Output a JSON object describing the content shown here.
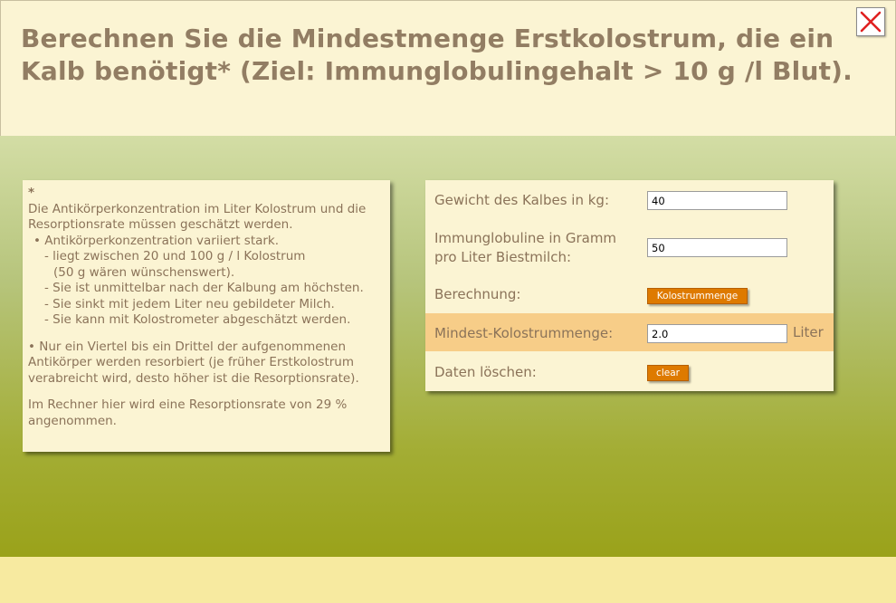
{
  "header": {
    "title": "Berechnen Sie die Mindestmenge Erstkolostrum, die ein Kalb benötigt* (Ziel: Immunglobulingehalt > 10 g /l Blut)."
  },
  "close_icon": "close-x-icon",
  "info": {
    "star": "*",
    "intro": "Die Antikörperkonzentration im Liter Kolostrum und die Resorptionsrate müssen geschätzt werden.",
    "bullet1": "• Antikörperkonzentration variiert stark.",
    "sub1": "- liegt zwischen 20 und 100 g / l Kolostrum",
    "sub1b": "(50 g wären wünschenswert).",
    "sub2": "- Sie ist unmittelbar nach der Kalbung am höchsten.",
    "sub3": "- Sie sinkt mit jedem Liter neu gebildeter Milch.",
    "sub4": "- Sie kann mit Kolostrometer abgeschätzt werden.",
    "bullet2": "• Nur ein Viertel bis ein Drittel der aufgenommenen Antikörper werden resorbiert (je früher Erstkolostrum verabreicht wird, desto höher ist die Resorptionsrate).",
    "note": "Im Rechner hier wird eine Resorptionsrate von 29 % angenommen."
  },
  "calc": {
    "weight_label": "Gewicht des Kalbes in kg:",
    "weight_value": "40",
    "igg_label_line1": "Immunglobuline in Gramm",
    "igg_label_line2": "pro Liter Biestmilch:",
    "igg_value": "50",
    "calc_label": "Berechnung:",
    "calc_button": "Kolostrummenge",
    "result_label": "Mindest-Kolostrummenge:",
    "result_value": "2.0",
    "result_unit": "Liter",
    "clear_label": "Daten löschen:",
    "clear_button": "clear"
  },
  "colors": {
    "title": "#927d63",
    "text": "#8b7359",
    "panel": "#fbf4d3",
    "result_band": "#f7cd88",
    "button": "#de7a00",
    "close_x": "#e02020"
  }
}
